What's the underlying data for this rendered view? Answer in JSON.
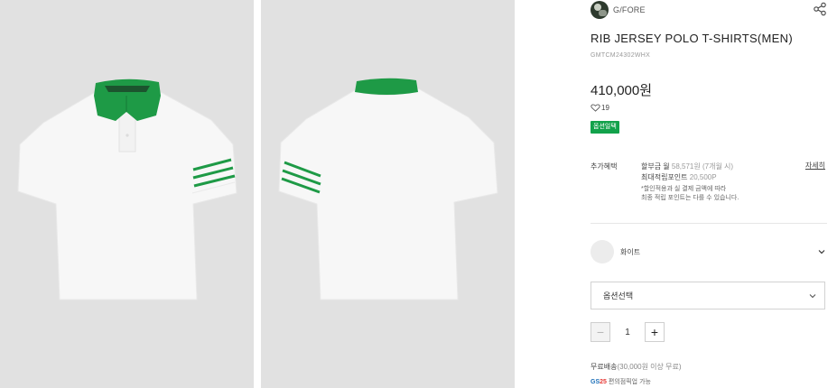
{
  "images": {
    "front_alt": "front",
    "back_alt": "back",
    "colors": {
      "background": "#e1e1e1",
      "shirt": "#f7f7f7",
      "accent": "#1e9a46"
    }
  },
  "brand": {
    "name": "G/FORE",
    "share_icon": "share-icon"
  },
  "product": {
    "name": "RIB JERSEY POLO T-SHIRTS(MEN)",
    "code": "GMTCM24302WHX",
    "price": "410,000원",
    "likes": "19",
    "badge": "옵션일택"
  },
  "benefits": {
    "label": "추가혜택",
    "installment_prefix": "할부금 월",
    "installment_amount": "58,571원",
    "installment_months": "(7개월 시)",
    "points_label": "최대적립포인트",
    "points_value": "20,500P",
    "note_line1": "*할인적용과 실 결제 금액에 따라",
    "note_line2": "최종 적립 포인트는 다를 수 있습니다.",
    "detail_link": "자세히"
  },
  "color_option": {
    "label": "화이트",
    "swatch_color": "#ececec"
  },
  "option_select": {
    "placeholder": "옵션선택"
  },
  "quantity": {
    "minus": "−",
    "value": "1",
    "plus": "+"
  },
  "shipping": {
    "label": "무료배송",
    "condition": "(30,000원 이상 무료)",
    "pickup_logo_main": "GS",
    "pickup_logo_num": "25",
    "pickup_text": "편의점픽업 가능"
  }
}
